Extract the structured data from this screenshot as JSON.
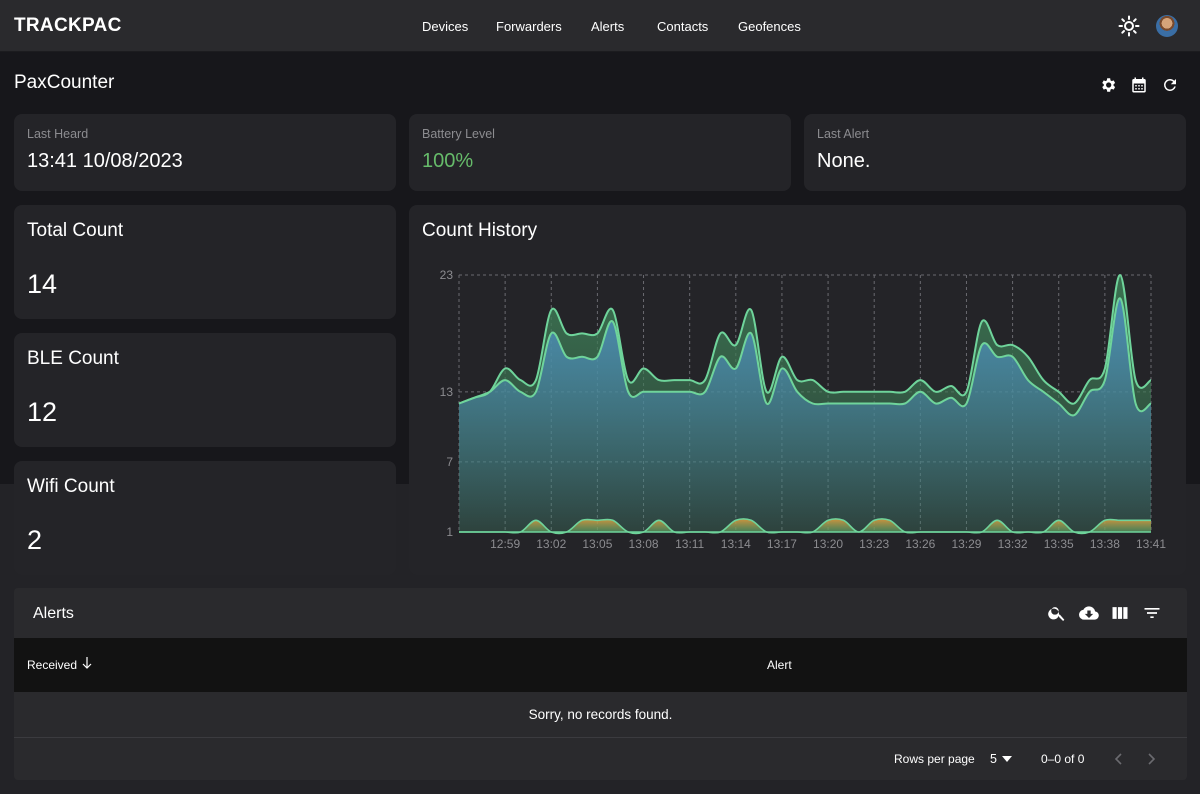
{
  "app": {
    "brand": "TRACKPAC"
  },
  "nav": {
    "items": [
      {
        "label": "Devices"
      },
      {
        "label": "Forwarders"
      },
      {
        "label": "Alerts"
      },
      {
        "label": "Contacts"
      },
      {
        "label": "Geofences"
      }
    ],
    "icons": {
      "theme": "sun-icon",
      "avatar": "user-avatar"
    }
  },
  "page": {
    "title": "PaxCounter",
    "actions": [
      "settings-icon",
      "calendar-icon",
      "refresh-icon"
    ]
  },
  "stats": {
    "last_heard": {
      "label": "Last Heard",
      "value": "13:41 10/08/2023"
    },
    "battery": {
      "label": "Battery Level",
      "value": "100%",
      "color": "#66bb6a"
    },
    "last_alert": {
      "label": "Last Alert",
      "value": "None."
    }
  },
  "counts": {
    "total": {
      "label": "Total Count",
      "value": "14"
    },
    "ble": {
      "label": "BLE Count",
      "value": "12"
    },
    "wifi": {
      "label": "Wifi Count",
      "value": "2"
    }
  },
  "chart_card": {
    "title": "Count History"
  },
  "chart_data": {
    "type": "area",
    "title": "Count History",
    "x": [
      "12:56",
      "12:57",
      "12:58",
      "12:59",
      "13:00",
      "13:01",
      "13:02",
      "13:03",
      "13:04",
      "13:05",
      "13:06",
      "13:07",
      "13:08",
      "13:09",
      "13:10",
      "13:11",
      "13:12",
      "13:13",
      "13:14",
      "13:15",
      "13:16",
      "13:17",
      "13:18",
      "13:19",
      "13:20",
      "13:21",
      "13:22",
      "13:23",
      "13:24",
      "13:25",
      "13:26",
      "13:27",
      "13:28",
      "13:29",
      "13:30",
      "13:31",
      "13:32",
      "13:33",
      "13:34",
      "13:35",
      "13:36",
      "13:37",
      "13:38",
      "13:39",
      "13:40",
      "13:41"
    ],
    "xticks": [
      "12:59",
      "13:02",
      "13:05",
      "13:08",
      "13:11",
      "13:14",
      "13:17",
      "13:20",
      "13:23",
      "13:26",
      "13:29",
      "13:32",
      "13:35",
      "13:38",
      "13:41"
    ],
    "yticks": [
      1,
      7,
      13,
      23
    ],
    "ylim": [
      1,
      23
    ],
    "series": [
      {
        "values": [
          12,
          12.5,
          13,
          15,
          14,
          14,
          20,
          18,
          18,
          18,
          20,
          14,
          15,
          14,
          14,
          14,
          14,
          18,
          17,
          20,
          13,
          16,
          14,
          14,
          13,
          13,
          13,
          13,
          13,
          13,
          14,
          13,
          13.5,
          13,
          19,
          17,
          17,
          16,
          14,
          13,
          12,
          14,
          15,
          23,
          14,
          14
        ],
        "color": "#6fd49b"
      },
      {
        "values": [
          12,
          12.5,
          13,
          14,
          13,
          13,
          18,
          16,
          16,
          16,
          19,
          13,
          13,
          13,
          13,
          13,
          13,
          16,
          15,
          18,
          12,
          15,
          13,
          12,
          12,
          12,
          12,
          12,
          12,
          12,
          13,
          12,
          12.5,
          12,
          17,
          16,
          16,
          14,
          13,
          12,
          11,
          13,
          14,
          21,
          12,
          12
        ],
        "color": "#4f93c4"
      },
      {
        "values": [
          1,
          1,
          1,
          1,
          1,
          2,
          1,
          1,
          2,
          2,
          2,
          1,
          1,
          2,
          1,
          1,
          1,
          1,
          2,
          2,
          1,
          1,
          1,
          1,
          2,
          2,
          1,
          2,
          2,
          1,
          1,
          1,
          1,
          1,
          1,
          2,
          1,
          1,
          1,
          2,
          1,
          1,
          2,
          2,
          2,
          2
        ],
        "color": "#e09c3c"
      },
      {
        "values": [
          1,
          1,
          1,
          1,
          1,
          2,
          1,
          1,
          2,
          2,
          2,
          1,
          1,
          2,
          1,
          1,
          1,
          1,
          2,
          2,
          1,
          1,
          1,
          1,
          2,
          2,
          1,
          2,
          2,
          1,
          1,
          1,
          1,
          1,
          1,
          2,
          1,
          1,
          1,
          2,
          1,
          1,
          2,
          2,
          2,
          2
        ],
        "color": "#6fd49b"
      }
    ],
    "grid": true
  },
  "alerts": {
    "title": "Alerts",
    "toolbar": [
      "search-icon",
      "cloud-download-icon",
      "view-columns-icon",
      "filter-icon"
    ],
    "columns": [
      {
        "label": "Received"
      },
      {
        "label": "Alert"
      }
    ],
    "empty_message": "Sorry, no records found.",
    "pagination": {
      "rows_label": "Rows per page",
      "rows_value": "5",
      "range": "0–0 of 0"
    }
  }
}
